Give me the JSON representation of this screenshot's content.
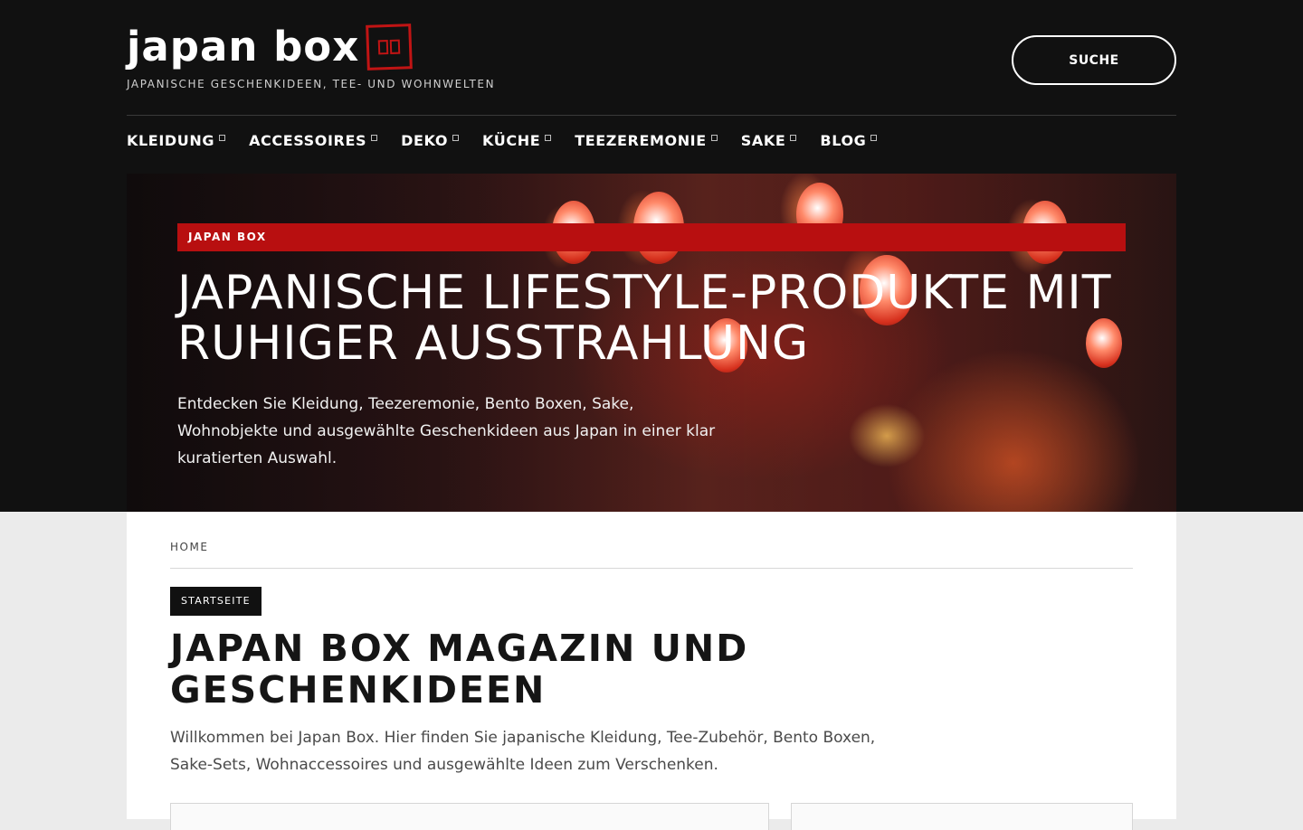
{
  "site": {
    "logo_text": "japan box",
    "logo_mark_icon": "hanko-stamp-icon",
    "tagline": "JAPANISCHE GESCHENKIDEEN, TEE- UND WOHNWELTEN",
    "search_label": "SUCHE"
  },
  "nav": {
    "items": [
      {
        "label": "KLEIDUNG"
      },
      {
        "label": "ACCESSOIRES"
      },
      {
        "label": "DEKO"
      },
      {
        "label": "KÜCHE"
      },
      {
        "label": "TEEZEREMONIE"
      },
      {
        "label": "SAKE"
      },
      {
        "label": "BLOG"
      }
    ]
  },
  "hero": {
    "tag": "JAPAN BOX",
    "title": "JAPANISCHE LIFESTYLE-PRODUKTE MIT RUHIGER AUSSTRAHLUNG",
    "description": "Entdecken Sie Kleidung, Teezeremonie, Bento Boxen, Sake, Wohnobjekte und ausgewählte Geschenkideen aus Japan in einer klar kuratierten Auswahl."
  },
  "main": {
    "breadcrumb": "HOME",
    "badge": "STARTSEITE",
    "title": "JAPAN BOX MAGAZIN UND GESCHENKIDEEN",
    "intro": "Willkommen bei Japan Box. Hier finden Sie japanische Kleidung, Tee-Zubehör, Bento Boxen, Sake-Sets, Wohnaccessoires und ausgewählte Ideen zum Verschenken."
  },
  "colors": {
    "header_bg": "#111111",
    "accent_red": "#b80f10",
    "page_bg": "#ebebeb"
  }
}
